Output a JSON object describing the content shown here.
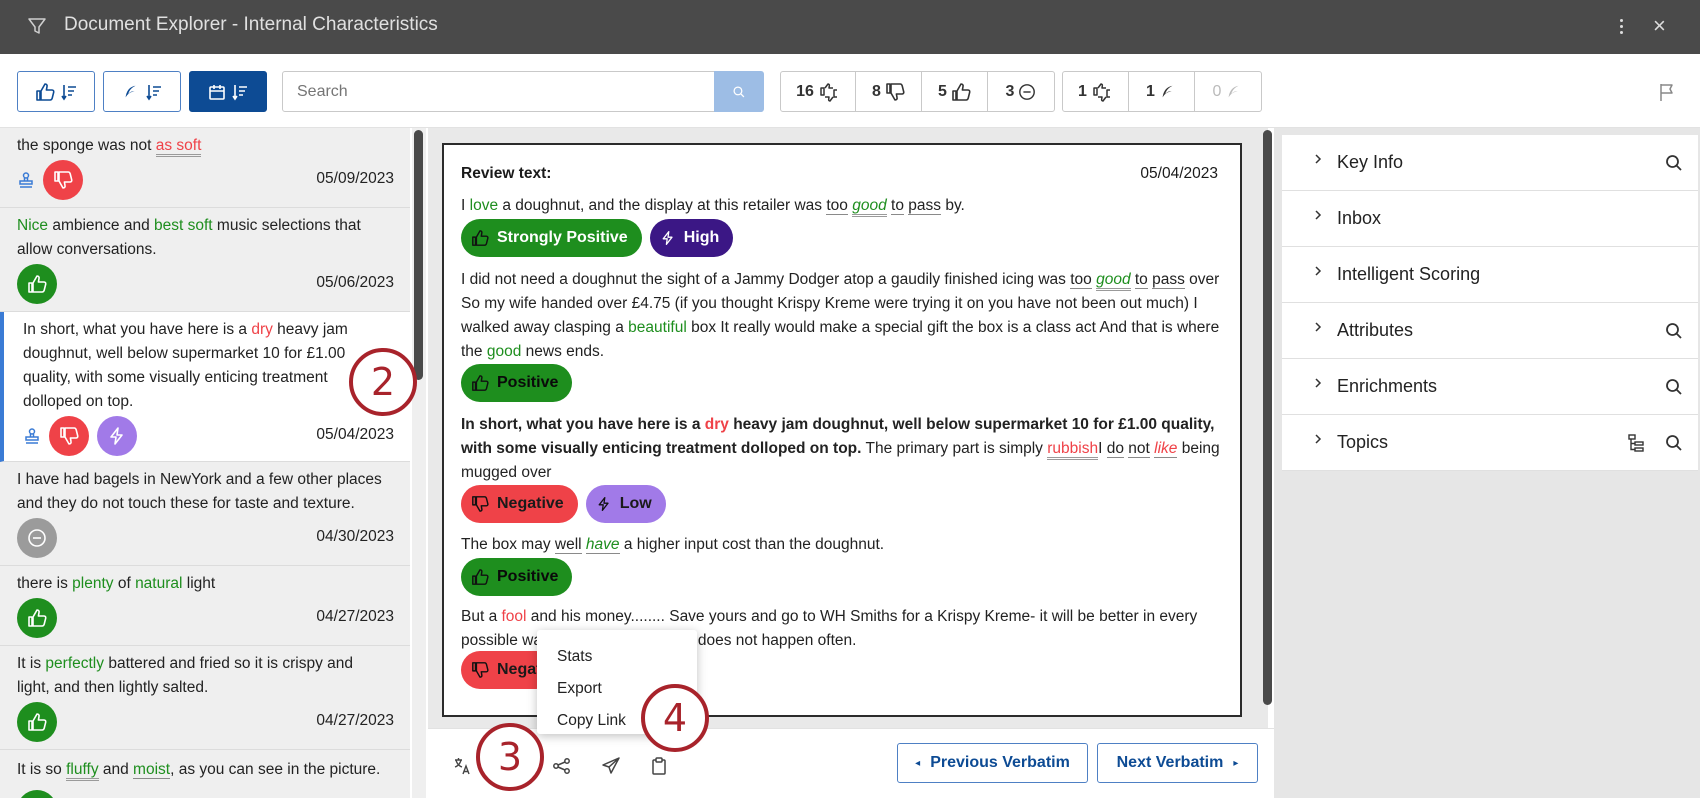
{
  "window": {
    "title": "Document Explorer - Internal Characteristics"
  },
  "toolbar": {
    "search_placeholder": "Search",
    "counts": [
      {
        "value": "16",
        "icon": "mixed-sentiment-icon"
      },
      {
        "value": "8",
        "icon": "thumbs-down-icon"
      },
      {
        "value": "5",
        "icon": "thumbs-up-icon"
      },
      {
        "value": "3",
        "icon": "neutral-icon"
      }
    ],
    "counts2": [
      {
        "value": "1",
        "icon": "mixed-sentiment-icon"
      },
      {
        "value": "1",
        "icon": "effort-icon"
      },
      {
        "value": "0",
        "icon": "effort-icon"
      }
    ]
  },
  "list": [
    {
      "date": "05/09/2023"
    },
    {
      "date": "05/06/2023"
    },
    {
      "date": "05/04/2023"
    },
    {
      "date": "04/30/2023"
    },
    {
      "date": "04/27/2023"
    },
    {
      "date": "04/27/2023"
    }
  ],
  "list_text": {
    "i1_a": "the sponge was not ",
    "i1_b": "as soft",
    "i2_a": "Nice",
    "i2_b": " ambience and ",
    "i2_c": "best soft",
    "i2_d": " music selections that allow conversations.",
    "i3_a": "In short, what you have here is a ",
    "i3_b": "dry",
    "i3_c": " heavy jam doughnut, well below supermarket 10 for £1.00 quality, with some visually enticing treatment dolloped on top.",
    "i4": "I have had bagels in NewYork and a few other places and they do not touch these for taste and texture.",
    "i5_a": "there is ",
    "i5_b": "plenty",
    "i5_c": " of ",
    "i5_d": "natural",
    "i5_e": " light",
    "i6_a": "It is ",
    "i6_b": "perfectly",
    "i6_c": " battered and fried so it is crispy and light, and then lightly salted.",
    "i7_a": "It is so ",
    "i7_b": "fluffy",
    "i7_c": " and ",
    "i7_d": "moist",
    "i7_e": ", as you can see in the picture."
  },
  "review": {
    "heading": "Review text:",
    "date": "05/04/2023",
    "p1": {
      "a": "I ",
      "b": "love",
      "c": " a doughnut, and the display at this retailer was ",
      "d": "too",
      "e": " ",
      "f": "good",
      "g": " ",
      "h": "to",
      "i": " ",
      "j": "pass",
      "k": " by."
    },
    "p2": {
      "a": "I did not need a doughnut the sight of a Jammy Dodger atop a gaudily finished icing was ",
      "b": "too",
      "c": " ",
      "d": "good",
      "e": " ",
      "f": "to",
      "g": " ",
      "h": "pass",
      "i": " over So my wife handed over £4.75 (if you thought Krispy Kreme were trying it on you have not been out much) I walked away clasping a ",
      "j": "beautiful",
      "k": " box It really would make a special gift the box is a class act And that is where the ",
      "l": "good",
      "m": " news ends."
    },
    "p3": {
      "a": "In short, what you have here is a ",
      "b": "dry",
      "c": " heavy jam doughnut, well below supermarket 10 for £1.00 quality, with some visually enticing treatment dolloped on top.",
      "d": " The primary part is simply ",
      "e": "rubbish",
      "f": "I ",
      "g": "do",
      "h": " ",
      "i": "not",
      "j": " ",
      "k": "like",
      "l": " being mugged over"
    },
    "p4": {
      "a": "The box may ",
      "b": "well",
      "c": " ",
      "d": "have",
      "e": " a higher input cost than the doughnut."
    },
    "p5": {
      "a": "But a ",
      "b": "fool",
      "c": " and his money........ Save yours and go to WH Smiths for a Krispy Kreme- it will be better in every possible wa",
      "d": "he bin, does not happen often."
    },
    "chips": {
      "strongly_positive": "Strongly Positive",
      "high": "High",
      "positive": "Positive",
      "negative": "Negative",
      "low": "Low",
      "negative_cut": "Negat"
    }
  },
  "menu": {
    "items": [
      "Stats",
      "Export",
      "Copy Link"
    ]
  },
  "nav": {
    "prev": "Previous Verbatim",
    "next": "Next Verbatim"
  },
  "callouts": {
    "c2": "2",
    "c3": "3",
    "c4": "4"
  },
  "panels": [
    {
      "label": "Key Info"
    },
    {
      "label": "Inbox"
    },
    {
      "label": "Intelligent Scoring"
    },
    {
      "label": "Attributes"
    },
    {
      "label": "Enrichments"
    },
    {
      "label": "Topics"
    }
  ],
  "colors": {
    "positive": "#1e8e1e",
    "negative": "#ef4248",
    "primary": "#0d4b94",
    "effort_high": "#3b1785",
    "effort_low": "#a17ae8",
    "callout": "#a8232b"
  }
}
